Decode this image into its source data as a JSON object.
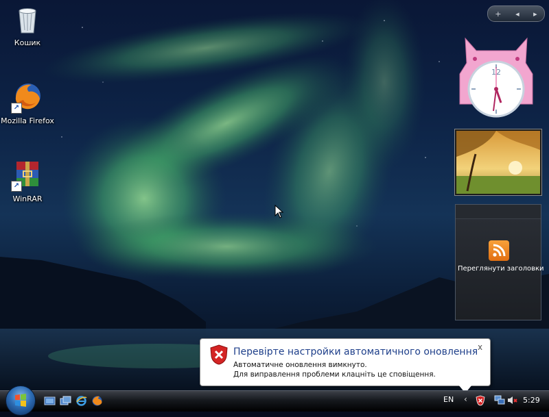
{
  "desktop": {
    "icons": [
      {
        "label": "Кошик",
        "icon": "recycle-bin-icon"
      },
      {
        "label": "Mozilla Firefox",
        "icon": "firefox-icon"
      },
      {
        "label": "WinRAR",
        "icon": "winrar-icon"
      }
    ]
  },
  "gadgets": {
    "toolbar": {
      "add": "+",
      "prev": "◂",
      "next": "▸"
    },
    "clock": {
      "label": "12",
      "hour_hand_value": "5",
      "minute_hand_value": "29"
    },
    "feed": {
      "label": "Переглянути заголовки",
      "icon": "rss-feed-icon"
    }
  },
  "notification": {
    "title": "Перевірте настройки автоматичного оновлення",
    "line1": "Автоматичне оновлення вимкнуто.",
    "line2": "Для виправлення проблеми клацніть це сповіщення.",
    "close": "x",
    "icon": "security-shield-error-icon"
  },
  "taskbar": {
    "language": "EN",
    "tray_chevron": "‹",
    "time": "5:29",
    "quick_launch": [
      "show-desktop-icon",
      "switch-windows-icon",
      "internet-explorer-icon",
      "firefox-icon"
    ]
  },
  "colors": {
    "aurora_green": "#7fe08a",
    "balloon_title": "#1e3f8a",
    "error_red": "#d42424"
  }
}
